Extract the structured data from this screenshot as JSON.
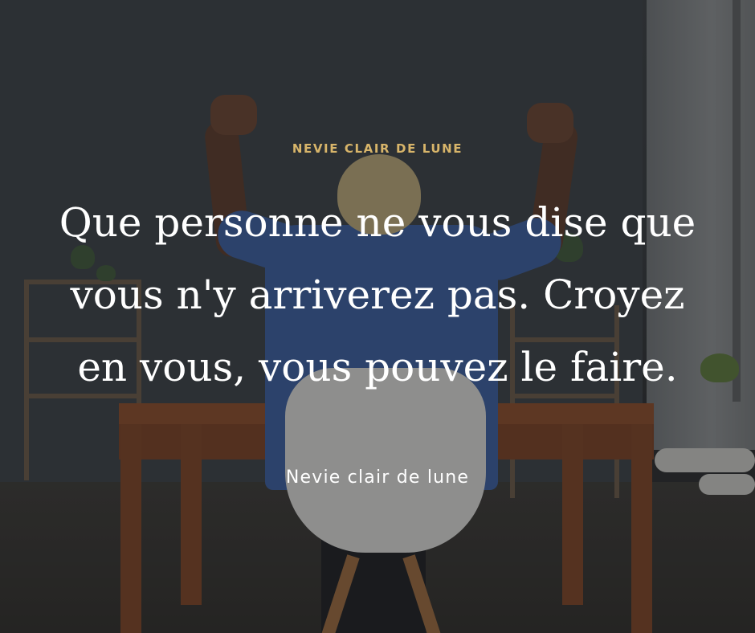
{
  "brand": "NEVIE CLAIR DE LUNE",
  "quote": {
    "lines": [
      "Que personne ne vous dise que",
      "vous n'y arriverez pas. Croyez",
      "en vous, vous pouvez le faire."
    ]
  },
  "signature": "Nevie clair de lune",
  "colors": {
    "brand_text": "#d8b56a",
    "quote_text": "#ffffff",
    "signature_text": "#ffffff"
  }
}
